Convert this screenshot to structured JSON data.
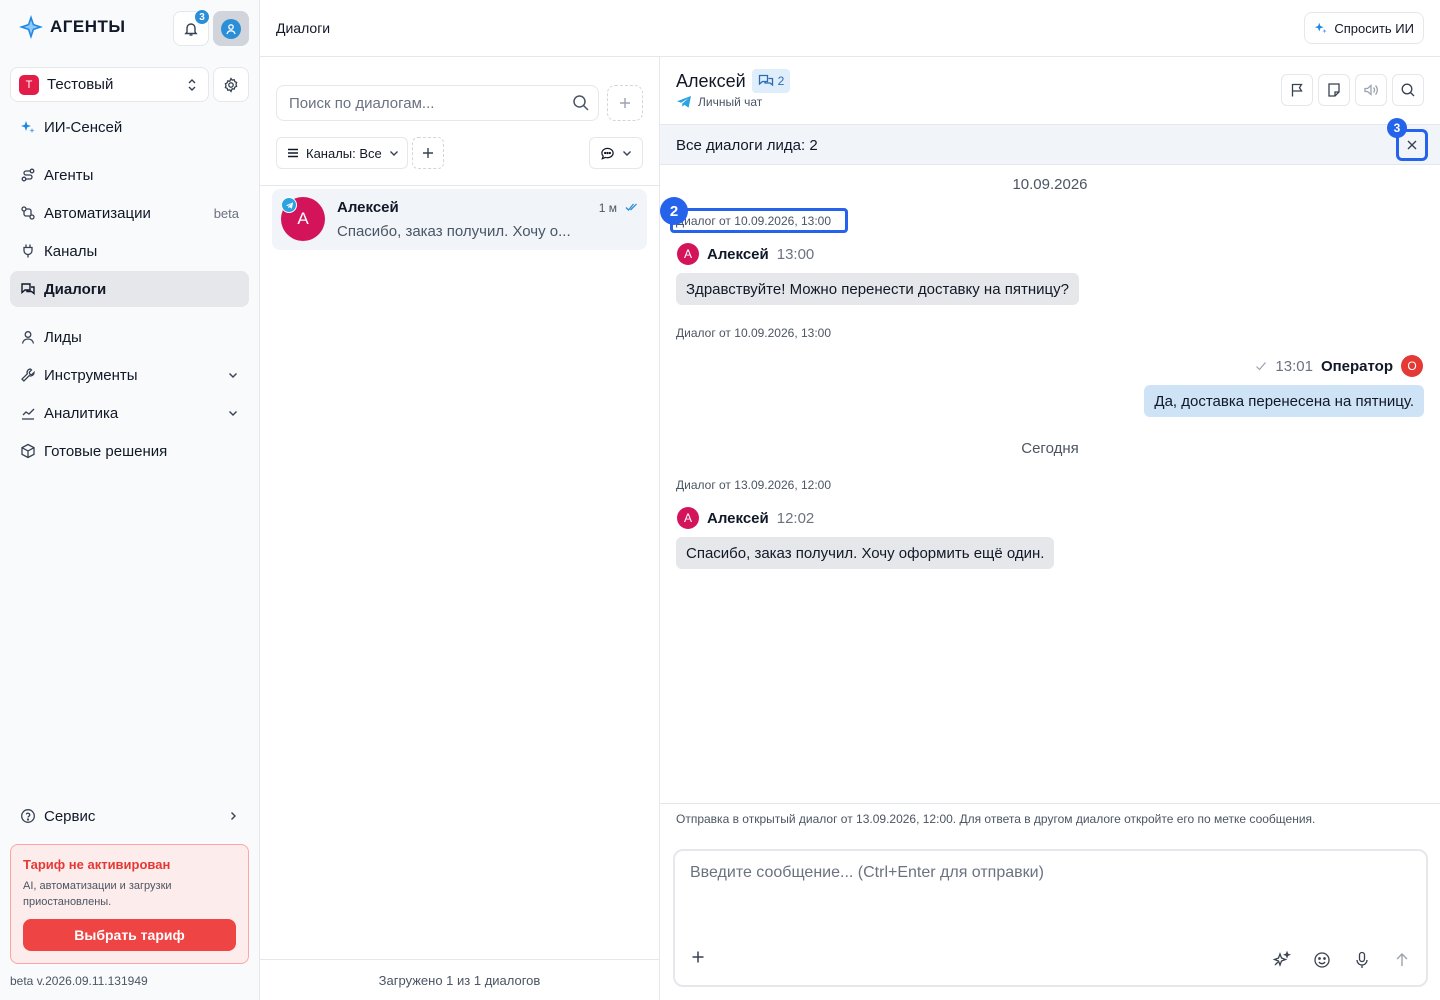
{
  "app": {
    "logo_text": "АГЕНТЫ",
    "notifications_count": "3",
    "page_title": "Диалоги",
    "ask_ai_label": "Спросить ИИ"
  },
  "workspace": {
    "avatar_letter": "Т",
    "name": "Тестовый"
  },
  "sidebar": {
    "items": [
      {
        "label": "ИИ-Сенсей",
        "icon": "sparkle-icon"
      },
      {
        "label": "Агенты",
        "icon": "route-icon"
      },
      {
        "label": "Автоматизации",
        "icon": "workflow-icon",
        "badge": "beta"
      },
      {
        "label": "Каналы",
        "icon": "plug-icon"
      },
      {
        "label": "Диалоги",
        "icon": "chats-icon",
        "active": true
      },
      {
        "label": "Лиды",
        "icon": "user-icon"
      },
      {
        "label": "Инструменты",
        "icon": "wrench-icon"
      },
      {
        "label": "Аналитика",
        "icon": "chart-icon"
      },
      {
        "label": "Готовые решения",
        "icon": "box-icon"
      }
    ],
    "service_label": "Сервис",
    "tariff": {
      "title": "Тариф не активирован",
      "description": "AI, автоматизации и загрузки приостановлены.",
      "button_label": "Выбрать тариф"
    },
    "version": "beta v.2026.09.11.131949"
  },
  "dialog_list": {
    "search_placeholder": "Поиск по диалогам...",
    "channels_filter_label": "Каналы: Все",
    "items": [
      {
        "avatar_letter": "А",
        "name": "Алексей",
        "time": "1 м",
        "preview": "Спасибо, заказ получил. Хочу о..."
      }
    ],
    "footer": "Загружено 1 из 1 диалогов"
  },
  "chat": {
    "contact_name": "Алексей",
    "dialogs_count": "2",
    "channel_label": "Личный чат",
    "lead_bar_text": "Все диалоги лида: 2",
    "markers": {
      "close": "3",
      "tag": "2"
    },
    "date_1": "10.09.2026",
    "date_2": "Сегодня",
    "messages": [
      {
        "tag": "Диалог от 10.09.2026, 13:00",
        "avatar_letter": "А",
        "sender": "Алексей",
        "time": "13:00",
        "text": "Здравствуйте! Можно перенести доставку на пятницу?"
      },
      {
        "tag": "Диалог от 10.09.2026, 13:00",
        "avatar_letter": "О",
        "sender": "Оператор",
        "time": "13:01",
        "text": "Да, доставка перенесена на пятницу."
      },
      {
        "tag": "Диалог от 13.09.2026, 12:00",
        "avatar_letter": "А",
        "sender": "Алексей",
        "time": "12:02",
        "text": "Спасибо, заказ получил. Хочу оформить ещё один."
      }
    ],
    "send_hint": "Отправка в открытый диалог от 13.09.2026, 12:00. Для ответа в другом диалоге откройте его по метке сообщения.",
    "composer_placeholder": "Введите сообщение... (Ctrl+Enter для отправки)"
  },
  "colors": {
    "accent": "#2563eb",
    "telegram": "#2aa3e0",
    "lead_avatar": "#d4145a",
    "operator_avatar": "#e53935",
    "danger": "#ef4444"
  }
}
